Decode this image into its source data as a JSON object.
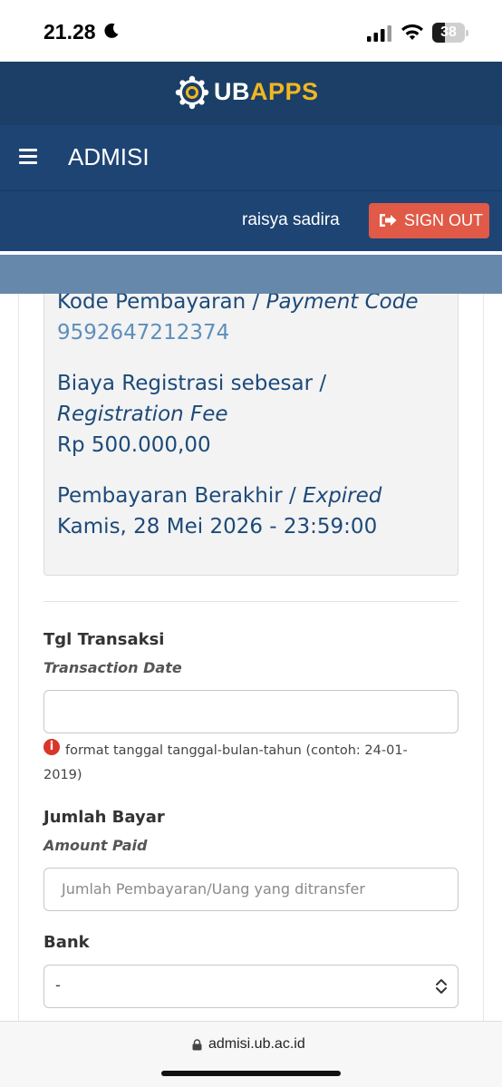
{
  "status_bar": {
    "time": "21.28",
    "battery_level": "38",
    "battery_fraction": 0.38,
    "icons": [
      "moon-icon",
      "cellular-signal-icon",
      "wifi-icon",
      "battery-icon"
    ]
  },
  "brand": {
    "name_part1": "UB",
    "name_part2": "APPS",
    "logo_icon": "ub-logo-icon",
    "colors": {
      "header_bg": "#1b3f66",
      "accent_yellow": "#f2b720",
      "nav_bg": "#1e4474"
    }
  },
  "nav": {
    "menu_icon": "hamburger-menu-icon",
    "title": "ADMISI"
  },
  "user": {
    "name": "raisya sadira",
    "signout_label": "SIGN OUT",
    "signout_icon": "sign-out-icon",
    "signout_color": "#e05a47"
  },
  "payment_info": {
    "code_label": "Kode Pembayaran / ",
    "code_label_en": "Payment Code",
    "code_value": "9592647212374",
    "fee_label": "Biaya Registrasi sebesar /",
    "fee_label_en": "Registration Fee",
    "fee_value": "Rp 500.000,00",
    "expiry_label": "Pembayaran Berakhir / ",
    "expiry_label_en": "Expired",
    "expiry_value": "Kamis, 28 Mei 2026 - 23:59:00"
  },
  "form": {
    "transaction_date": {
      "label": "Tgl Transaksi",
      "sublabel": "Transaction Date",
      "value": "",
      "hint_icon": "info-circle-icon",
      "hint": "format tanggal tanggal-bulan-tahun (contoh: 24-01-2019)"
    },
    "amount_paid": {
      "label": "Jumlah Bayar",
      "sublabel": "Amount Paid",
      "placeholder": "Jumlah Pembayaran/Uang yang ditransfer"
    },
    "bank": {
      "label": "Bank",
      "selected": "-"
    }
  },
  "browser": {
    "url": "admisi.ub.ac.id",
    "lock_icon": "lock-icon"
  }
}
